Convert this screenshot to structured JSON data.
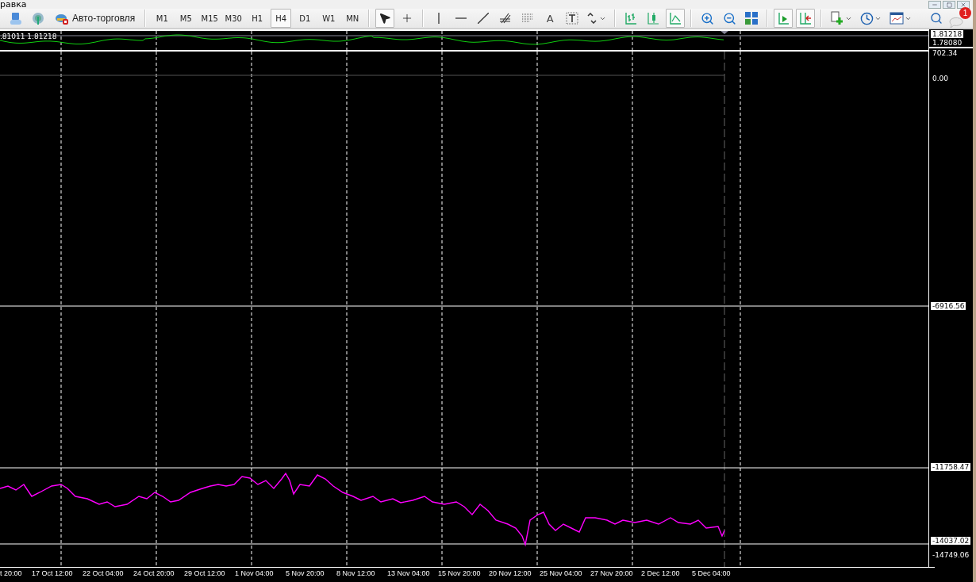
{
  "menu": {
    "last_item": "равка"
  },
  "toolbar": {
    "auto_trading": {
      "label": "Авто-торговля"
    },
    "timeframes": [
      {
        "label": "M1",
        "selected": false
      },
      {
        "label": "M5",
        "selected": false
      },
      {
        "label": "M15",
        "selected": false
      },
      {
        "label": "M30",
        "selected": false
      },
      {
        "label": "H1",
        "selected": false
      },
      {
        "label": "H4",
        "selected": true
      },
      {
        "label": "D1",
        "selected": false
      },
      {
        "label": "W1",
        "selected": false
      },
      {
        "label": "MN",
        "selected": false
      }
    ],
    "pointer_tools": [
      {
        "kind": "cursor",
        "selected": true
      },
      {
        "kind": "crosshair",
        "selected": false
      }
    ],
    "text_tool": {
      "label": "A"
    },
    "chart_types": [
      {
        "kind": "bars",
        "selected": false
      },
      {
        "kind": "candles",
        "selected": false
      },
      {
        "kind": "line",
        "selected": true
      }
    ],
    "navigation": [
      {
        "kind": "autoscroll",
        "selected": true
      },
      {
        "kind": "shift",
        "selected": true
      }
    ],
    "notifications": {
      "count": "1"
    }
  },
  "indicator_window": {
    "legend": ".81011 1.81218",
    "scale": [
      {
        "label": "1.81218",
        "highlighted": true
      },
      {
        "label": "1.78080",
        "highlighted": false
      }
    ]
  },
  "main_window": {
    "scale": [
      {
        "label": "702.34",
        "highlighted": false
      },
      {
        "label": "0.00",
        "highlighted": false
      },
      {
        "label": "-6916.56",
        "highlighted": true
      },
      {
        "label": "-11758.47",
        "highlighted": true
      },
      {
        "label": "-14037.02",
        "highlighted": true
      },
      {
        "label": "-14749.06",
        "highlighted": false
      }
    ]
  },
  "time_axis": [
    "t 20:00",
    "17 Oct 12:00",
    "22 Oct 04:00",
    "24 Oct 20:00",
    "29 Oct 12:00",
    "1 Nov 04:00",
    "5 Nov 20:00",
    "8 Nov 12:00",
    "13 Nov 04:00",
    "15 Nov 20:00",
    "20 Nov 12:00",
    "25 Nov 04:00",
    "27 Nov 20:00",
    "2 Dec 12:00",
    "5 Dec 04:00"
  ]
}
